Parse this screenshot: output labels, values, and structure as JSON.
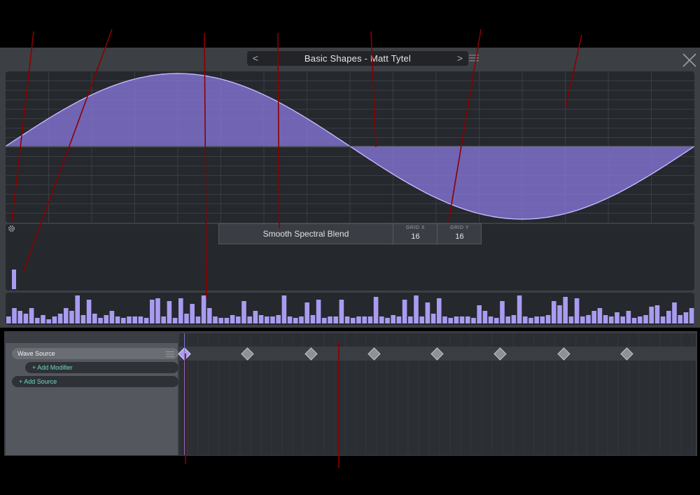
{
  "header": {
    "title": "Basic Shapes  -  Matt Tytel",
    "prev_label": "<",
    "next_label": ">"
  },
  "editor": {
    "blend_mode": "Smooth Spectral Blend",
    "grid_x_label": "GRID X",
    "grid_x_value": "16",
    "grid_y_label": "GRID Y",
    "grid_y_value": "16"
  },
  "sources": {
    "wave_source": "Wave Source",
    "add_modifier": "+  Add Modifier",
    "add_source": "+  Add Source"
  },
  "keyframes": {
    "count": 8,
    "selected_index": 0
  },
  "spectrum": {
    "bars": [
      10,
      22,
      18,
      14,
      22,
      8,
      12,
      6,
      10,
      14,
      22,
      18,
      40,
      12,
      34,
      14,
      8,
      12,
      18,
      10,
      8,
      10,
      10,
      10,
      8,
      34,
      36,
      10,
      32,
      8,
      36,
      14,
      28,
      10,
      40,
      22,
      10,
      8,
      8,
      12,
      10,
      32,
      10,
      18,
      12,
      10,
      10,
      12,
      40,
      10,
      8,
      10,
      30,
      12,
      34,
      8,
      10,
      10,
      34,
      10,
      8,
      10,
      10,
      10,
      38,
      10,
      8,
      12,
      10,
      34,
      10,
      40,
      10,
      30,
      14,
      36,
      10,
      8,
      10,
      10,
      10,
      8,
      26,
      18,
      10,
      8,
      32,
      10,
      12,
      40,
      10,
      8,
      10,
      10,
      12,
      32,
      26,
      38,
      10,
      36,
      10,
      12,
      18,
      22,
      12,
      10,
      16,
      10,
      18,
      8,
      10,
      12,
      24,
      26,
      10,
      18,
      30,
      12,
      16,
      22
    ]
  },
  "colors": {
    "accent": "#a99bf0",
    "wave_fill": "#8a78e0",
    "teal": "#6fd9c4",
    "callout": "#8b0000"
  }
}
